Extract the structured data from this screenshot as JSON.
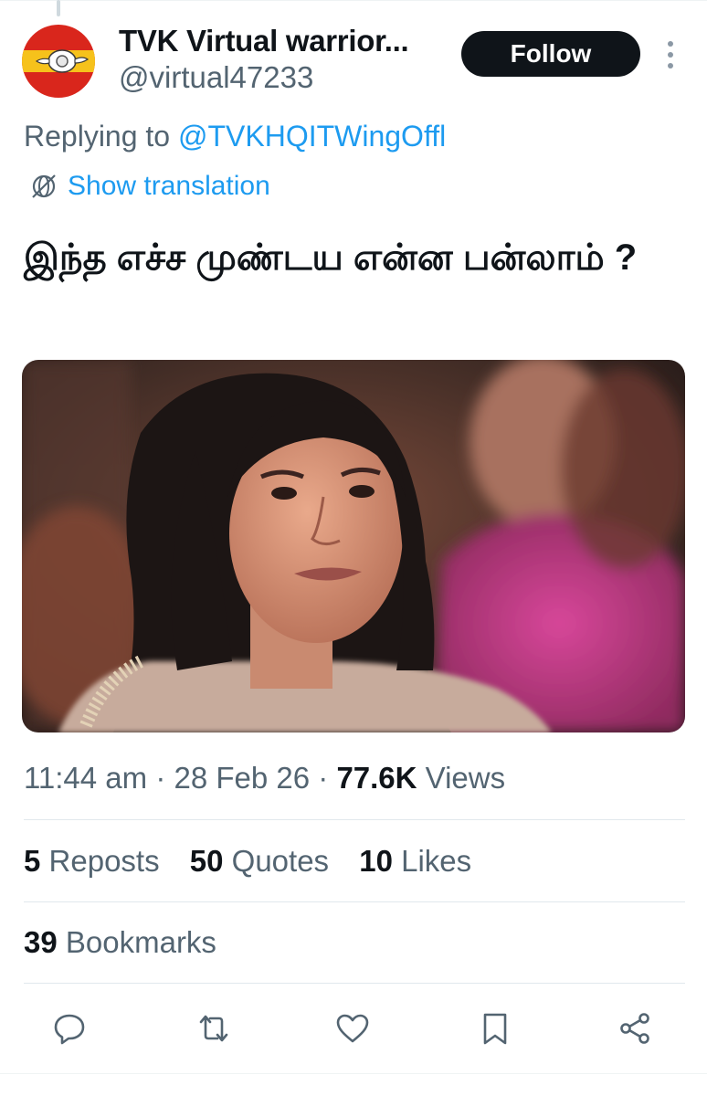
{
  "author": {
    "display_name": "TVK Virtual warrior...",
    "handle": "@virtual47233"
  },
  "follow_label": "Follow",
  "reply": {
    "prefix": "Replying to ",
    "mention": "@TVKHQITWingOffl"
  },
  "translation_label": "Show translation",
  "tweet_text": "இந்த எச்ச முண்டய என்ன பன்லாம் ?",
  "meta": {
    "time": "11:44 am",
    "separator": " · ",
    "date": "28 Feb 26",
    "views_count": "77.6K",
    "views_label": " Views"
  },
  "stats": {
    "reposts_count": "5",
    "reposts_label": " Reposts",
    "quotes_count": "50",
    "quotes_label": " Quotes",
    "likes_count": "10",
    "likes_label": " Likes",
    "bookmarks_count": "39",
    "bookmarks_label": " Bookmarks"
  },
  "colors": {
    "accent": "#1d9bf0",
    "text": "#0f1419",
    "secondary_text": "#536471",
    "follow_button_bg": "#0f1419",
    "avatar_red": "#d9261c",
    "avatar_yellow": "#f6c21b"
  },
  "icons": {
    "more": "more-vertical-icon",
    "translate": "globe-icon",
    "reply": "reply-icon",
    "repost": "repost-icon",
    "like": "heart-icon",
    "bookmark": "bookmark-icon",
    "share": "share-icon"
  }
}
